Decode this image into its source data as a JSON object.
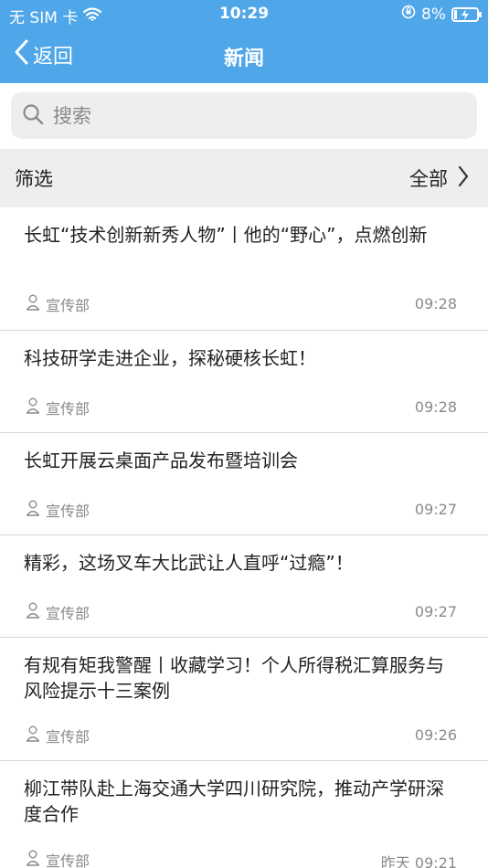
{
  "status_bar": {
    "carrier": "无 SIM 卡",
    "time": "10:29",
    "battery": "8%"
  },
  "nav": {
    "back_label": "返回",
    "title": "新闻"
  },
  "search": {
    "placeholder": "搜索"
  },
  "filter": {
    "label": "筛选",
    "value": "全部"
  },
  "news": [
    {
      "title": "长虹“技术创新新秀人物”丨他的“野心”，点燃创新",
      "dept": "宣传部",
      "time": "09:28"
    },
    {
      "title": "科技研学走进企业，探秘硬核长虹！",
      "dept": "宣传部",
      "time": "09:28"
    },
    {
      "title": "长虹开展云桌面产品发布暨培训会",
      "dept": "宣传部",
      "time": "09:27"
    },
    {
      "title": "精彩，这场叉车大比武让人直呼“过瘾”！",
      "dept": "宣传部",
      "time": "09:27"
    },
    {
      "title": "有规有矩我警醒丨收藏学习！个人所得税汇算服务与风险提示十三案例",
      "dept": "宣传部",
      "time": "09:26"
    },
    {
      "title": "柳江带队赴上海交通大学四川研究院，推动产学研深度合作",
      "dept": "宣传部",
      "time": "昨天 09:21"
    }
  ],
  "colors": {
    "header": "#4fa6e8",
    "filter_bg": "#eeeeee",
    "meta_text": "#8a8a8a"
  }
}
